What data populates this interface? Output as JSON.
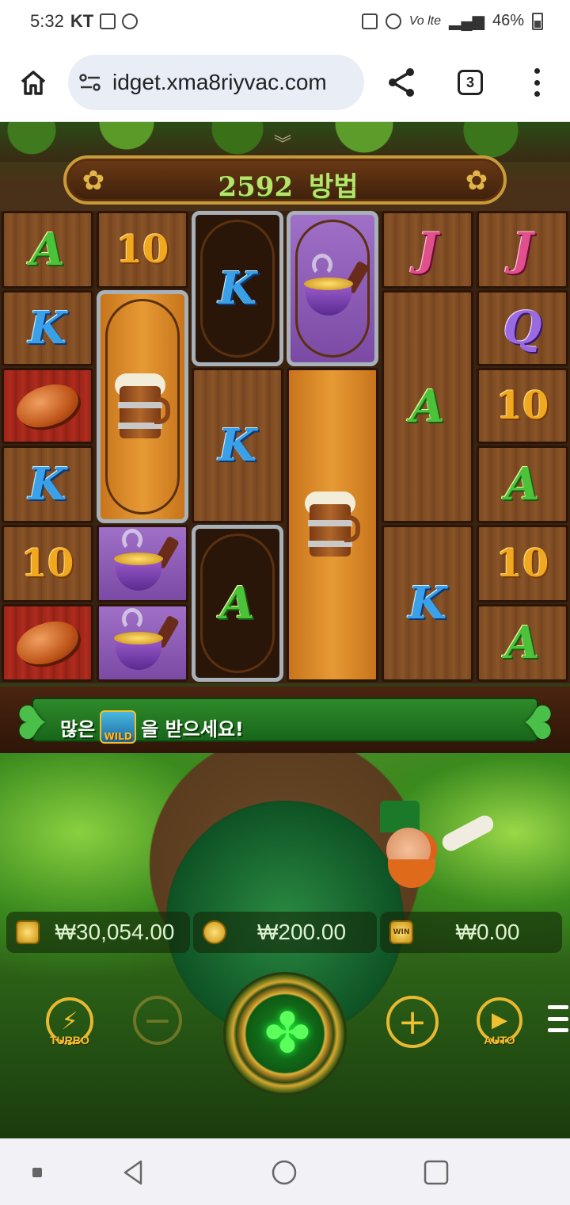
{
  "status_bar": {
    "time": "5:32",
    "carrier": "KT",
    "battery": "46%"
  },
  "browser": {
    "url": "idget.xma8riyvac.com",
    "tab_count": "3"
  },
  "game": {
    "ways_count": "2592",
    "ways_label": "방법",
    "banner_prefix": "많은",
    "banner_suffix": "을 받으세요!",
    "wild_label": "WILD",
    "reels": [
      [
        "A",
        "K",
        "bread",
        "K",
        "10",
        "bread"
      ],
      [
        "10",
        "beer-mug",
        "pipe",
        "pipe"
      ],
      [
        "K",
        "K",
        "A"
      ],
      [
        "pipe",
        "beer-mug"
      ],
      [
        "J",
        "A",
        "K"
      ],
      [
        "J",
        "Q",
        "10",
        "A",
        "10",
        "A"
      ]
    ],
    "balance": "₩30,054.00",
    "bet": "₩200.00",
    "win": "₩0.00",
    "win_icon_label": "WIN",
    "turbo_label": "TURBO",
    "auto_label": "AUTO"
  }
}
